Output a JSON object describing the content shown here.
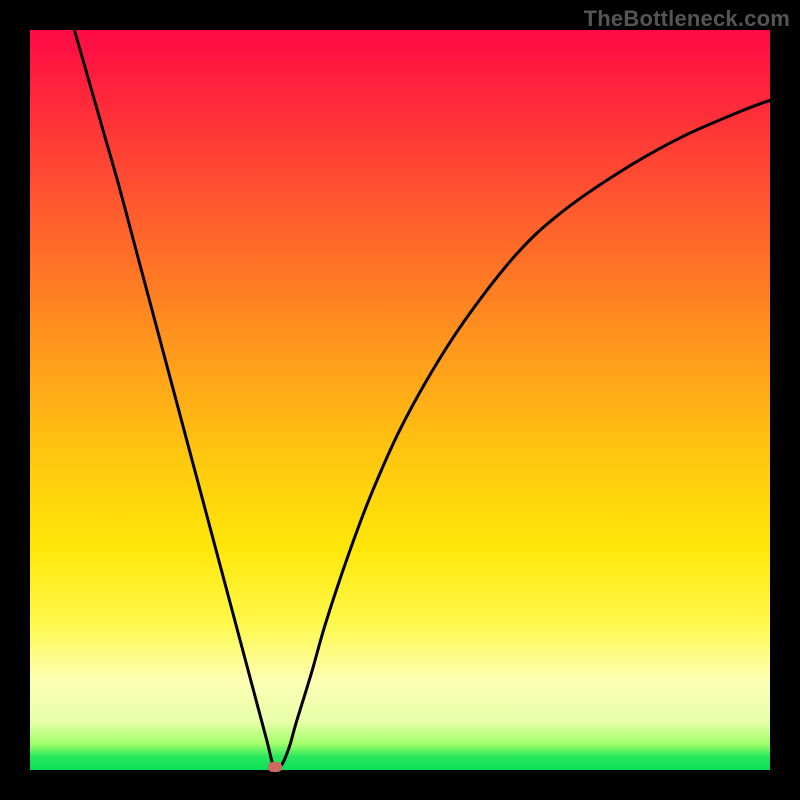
{
  "watermark": "TheBottleneck.com",
  "chart_data": {
    "type": "line",
    "title": "",
    "xlabel": "",
    "ylabel": "",
    "xlim": [
      0,
      100
    ],
    "ylim": [
      0,
      100
    ],
    "legend": null,
    "grid": false,
    "gradient_bands": [
      {
        "y_pct": 0,
        "color": "#ff0a46"
      },
      {
        "y_pct": 50,
        "color": "#ffb010"
      },
      {
        "y_pct": 82,
        "color": "#fff84a"
      },
      {
        "y_pct": 95,
        "color": "#b8ff80"
      },
      {
        "y_pct": 100,
        "color": "#0adf58"
      }
    ],
    "series": [
      {
        "name": "bottleneck-curve",
        "x": [
          6,
          8,
          10,
          12,
          14,
          16,
          18,
          20,
          22,
          24,
          26,
          28,
          30,
          32,
          33,
          34,
          35,
          36,
          38,
          40,
          43,
          46,
          50,
          55,
          60,
          66,
          72,
          80,
          88,
          96,
          100
        ],
        "y": [
          100,
          93,
          86,
          79,
          71.5,
          64,
          56.5,
          49,
          41.5,
          34,
          26.5,
          19,
          11.5,
          4,
          0.3,
          0.7,
          3,
          6.5,
          13,
          20,
          29,
          37,
          46,
          55,
          62.5,
          70,
          75.5,
          81,
          85.5,
          89,
          90.5
        ]
      }
    ],
    "marker": {
      "x": 33.1,
      "y": 0.4,
      "shape": "ellipse",
      "color": "#cc6b63"
    }
  }
}
